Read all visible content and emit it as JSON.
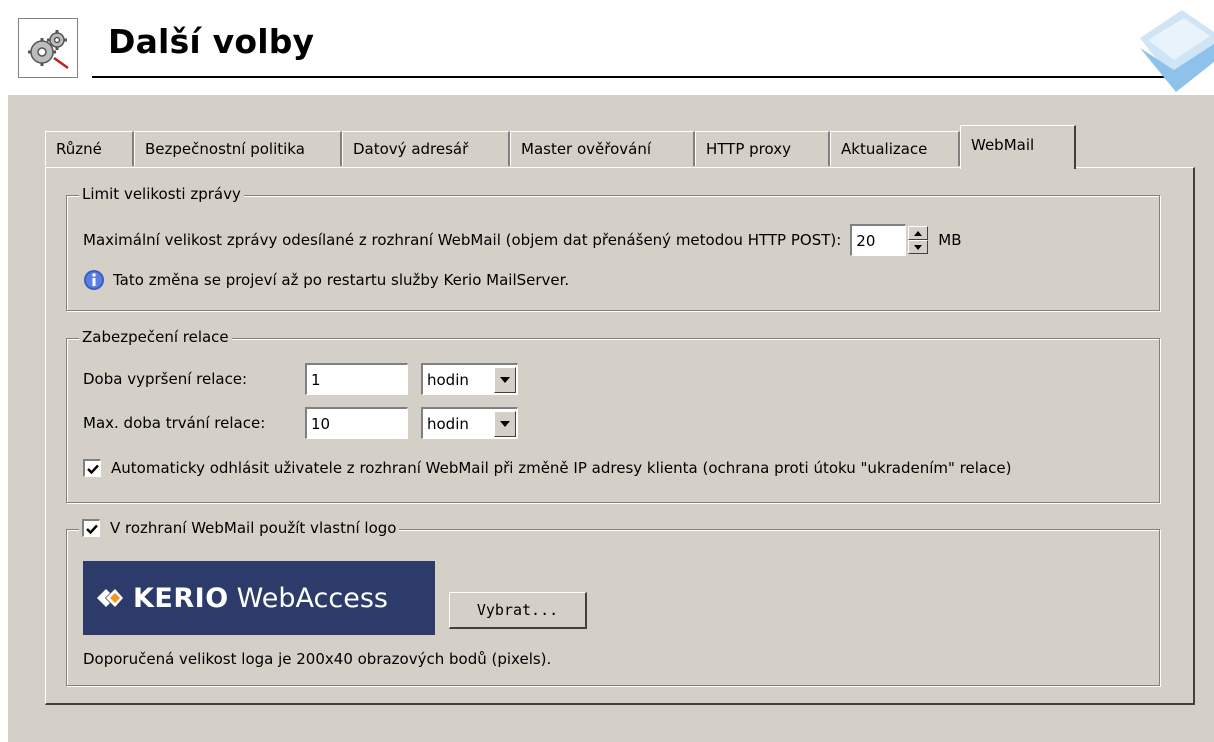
{
  "header": {
    "title": "Další volby",
    "settings_icon": "gears-icon",
    "brand_icon": "kerio-diamond-icon"
  },
  "tabs": [
    {
      "label": "Různé"
    },
    {
      "label": "Bezpečnostní politika"
    },
    {
      "label": "Datový adresář"
    },
    {
      "label": "Master ověřování"
    },
    {
      "label": "HTTP proxy"
    },
    {
      "label": "Aktualizace"
    },
    {
      "label": "WebMail",
      "active": true
    }
  ],
  "size_limit": {
    "legend": "Limit velikosti zprávy",
    "label": "Maximální velikost zprávy odesílané z rozhraní WebMail (objem dat přenášený metodou HTTP POST):",
    "value": "20",
    "unit": "MB",
    "info_icon": "info-icon",
    "note": "Tato změna se projeví až po restartu služby Kerio MailServer."
  },
  "session": {
    "legend": "Zabezpečení relace",
    "timeout_label": "Doba vypršení relace:",
    "timeout_value": "1",
    "timeout_unit": "hodin",
    "max_label": "Max. doba trvání relace:",
    "max_value": "10",
    "max_unit": "hodin",
    "auto_logout_checked": true,
    "auto_logout_label": "Automaticky odhlásit uživatele z rozhraní WebMail při změně IP adresy klienta (ochrana proti útoku \"ukradením\" relace)"
  },
  "logo": {
    "checked": true,
    "legend": "V rozhraní WebMail použít vlastní logo",
    "preview_strong": "KERIO",
    "preview_light": "WebAccess",
    "choose_button": "Vybrat...",
    "hint": "Doporučená velikost loga je 200x40 obrazových bodů (pixels)."
  },
  "colors": {
    "dialog_bg": "#d4d0c8",
    "logo_bg": "#2d3b6a",
    "logo_accent": "#f7941d",
    "info_blue": "#3b5fc0"
  }
}
